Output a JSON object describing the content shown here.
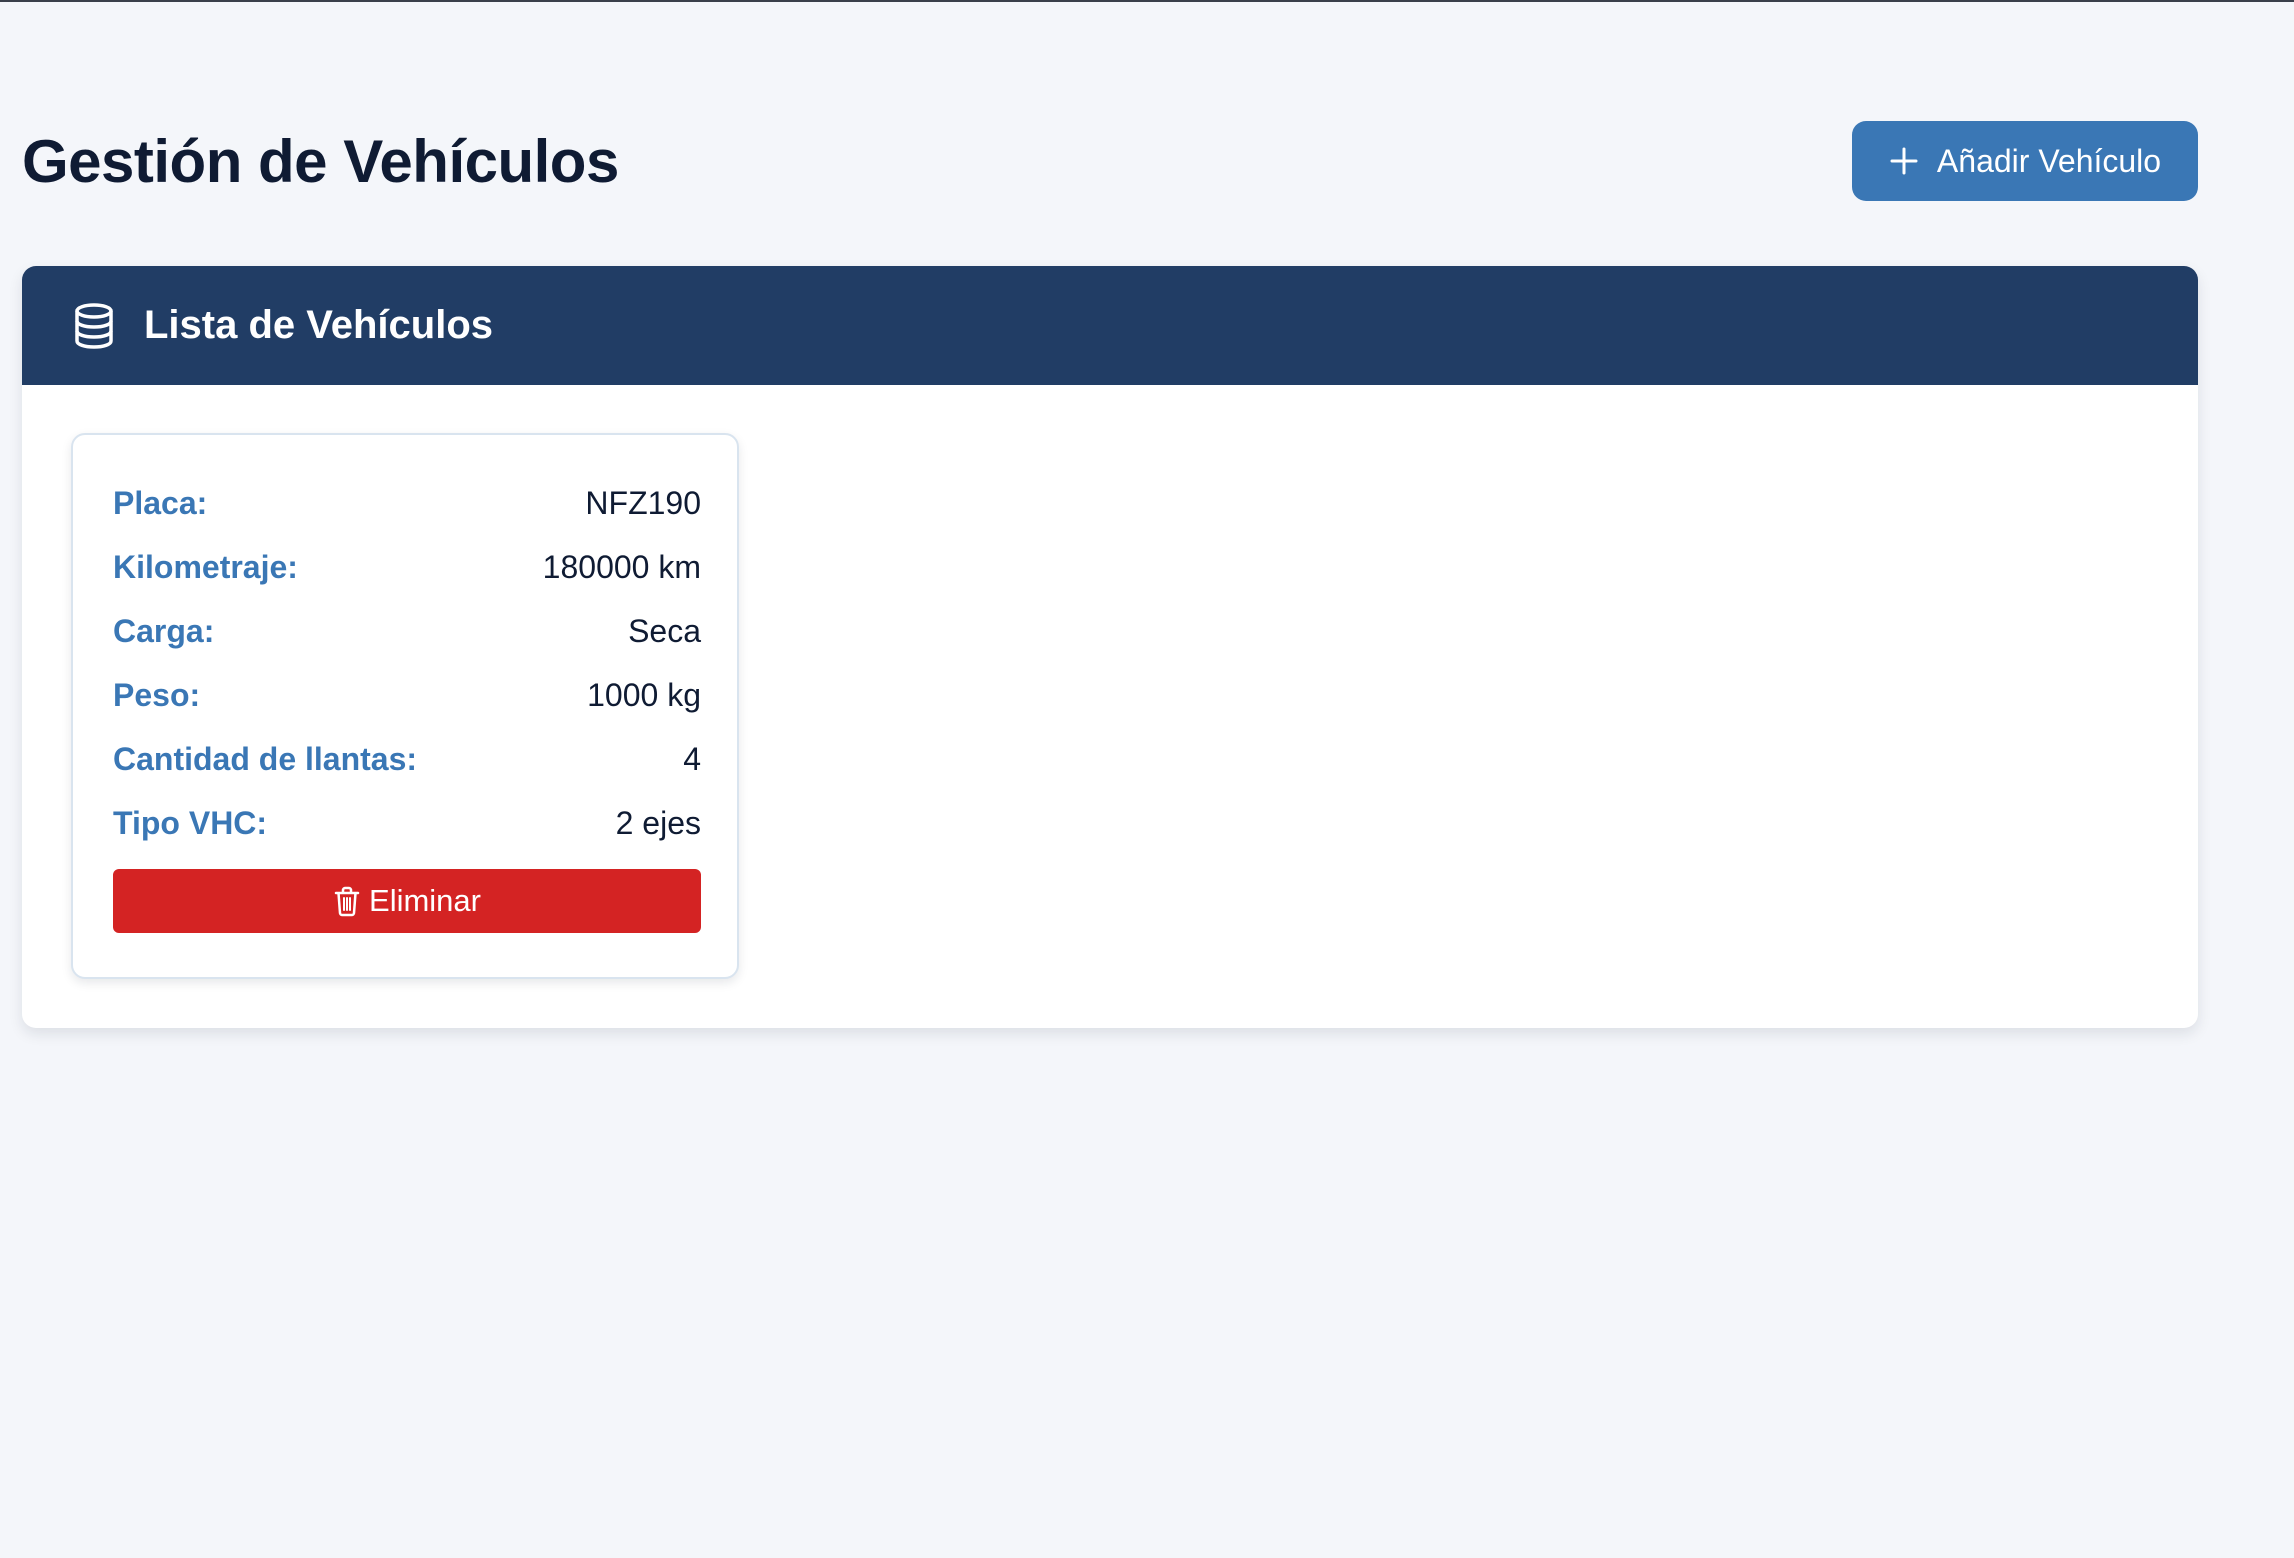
{
  "page": {
    "title": "Gestión de Vehículos",
    "add_button_label": "Añadir Vehículo",
    "add_button_icon": "plus-icon"
  },
  "panel": {
    "title": "Lista de Vehículos",
    "icon": "database-icon"
  },
  "vehicles": [
    {
      "fields": [
        {
          "label": "Placa:",
          "value": "NFZ190"
        },
        {
          "label": "Kilometraje:",
          "value": "180000 km"
        },
        {
          "label": "Carga:",
          "value": "Seca"
        },
        {
          "label": "Peso:",
          "value": "1000 kg"
        },
        {
          "label": "Cantidad de llantas:",
          "value": "4"
        },
        {
          "label": "Tipo VHC:",
          "value": "2 ejes"
        }
      ],
      "delete_label": "Eliminar",
      "delete_icon": "trash-icon"
    }
  ],
  "colors": {
    "page_background": "#f4f6fa",
    "primary": "#3a77b5",
    "header": "#213d65",
    "danger": "#d42323",
    "text": "#0f1b33"
  }
}
